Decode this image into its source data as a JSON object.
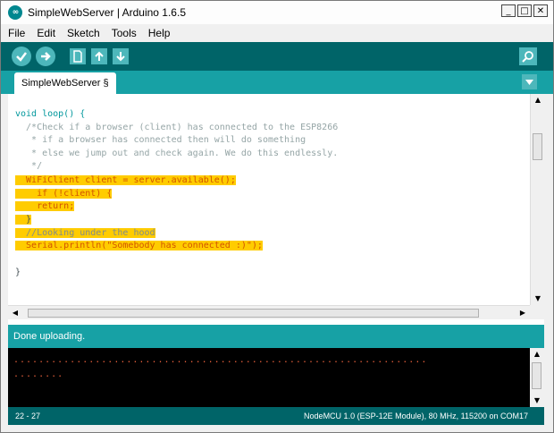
{
  "window": {
    "title": "SimpleWebServer | Arduino 1.6.5",
    "controls": {
      "minimize": "_",
      "maximize": "□",
      "close": "✕"
    }
  },
  "menu": [
    "File",
    "Edit",
    "Sketch",
    "Tools",
    "Help"
  ],
  "toolbar": {
    "verify": "verify-icon",
    "upload": "upload-arrow-icon",
    "new": "new-file-icon",
    "open": "open-arrow-up-icon",
    "save": "save-arrow-down-icon",
    "serial_monitor": "magnifier-icon"
  },
  "tab": {
    "label": "SimpleWebServer §"
  },
  "code": {
    "lines": [
      "void loop() {",
      "  /*Check if a browser (client) has connected to the ESP8266",
      "   * if a browser has connected then will do something",
      "   * else we jump out and check again. We do this endlessly.",
      "   */",
      "  WiFiClient client = server.available();",
      "    if (!client) {",
      "    return;",
      "  }",
      "  //Looking under the hood",
      "  Serial.println(\"Somebody has connected :)\");",
      "",
      "}"
    ]
  },
  "status": {
    "message": "Done uploading."
  },
  "console": {
    "line1": "..................................................................",
    "line2": "........"
  },
  "footer": {
    "cursor": "22 - 27",
    "board": "NodeMCU 1.0 (ESP-12E Module), 80 MHz, 115200 on COM17"
  },
  "colors": {
    "toolbar_bg": "#006468",
    "tab_bg": "#17a1a5",
    "button": "#4db7bb",
    "highlight": "#ffcc00"
  }
}
